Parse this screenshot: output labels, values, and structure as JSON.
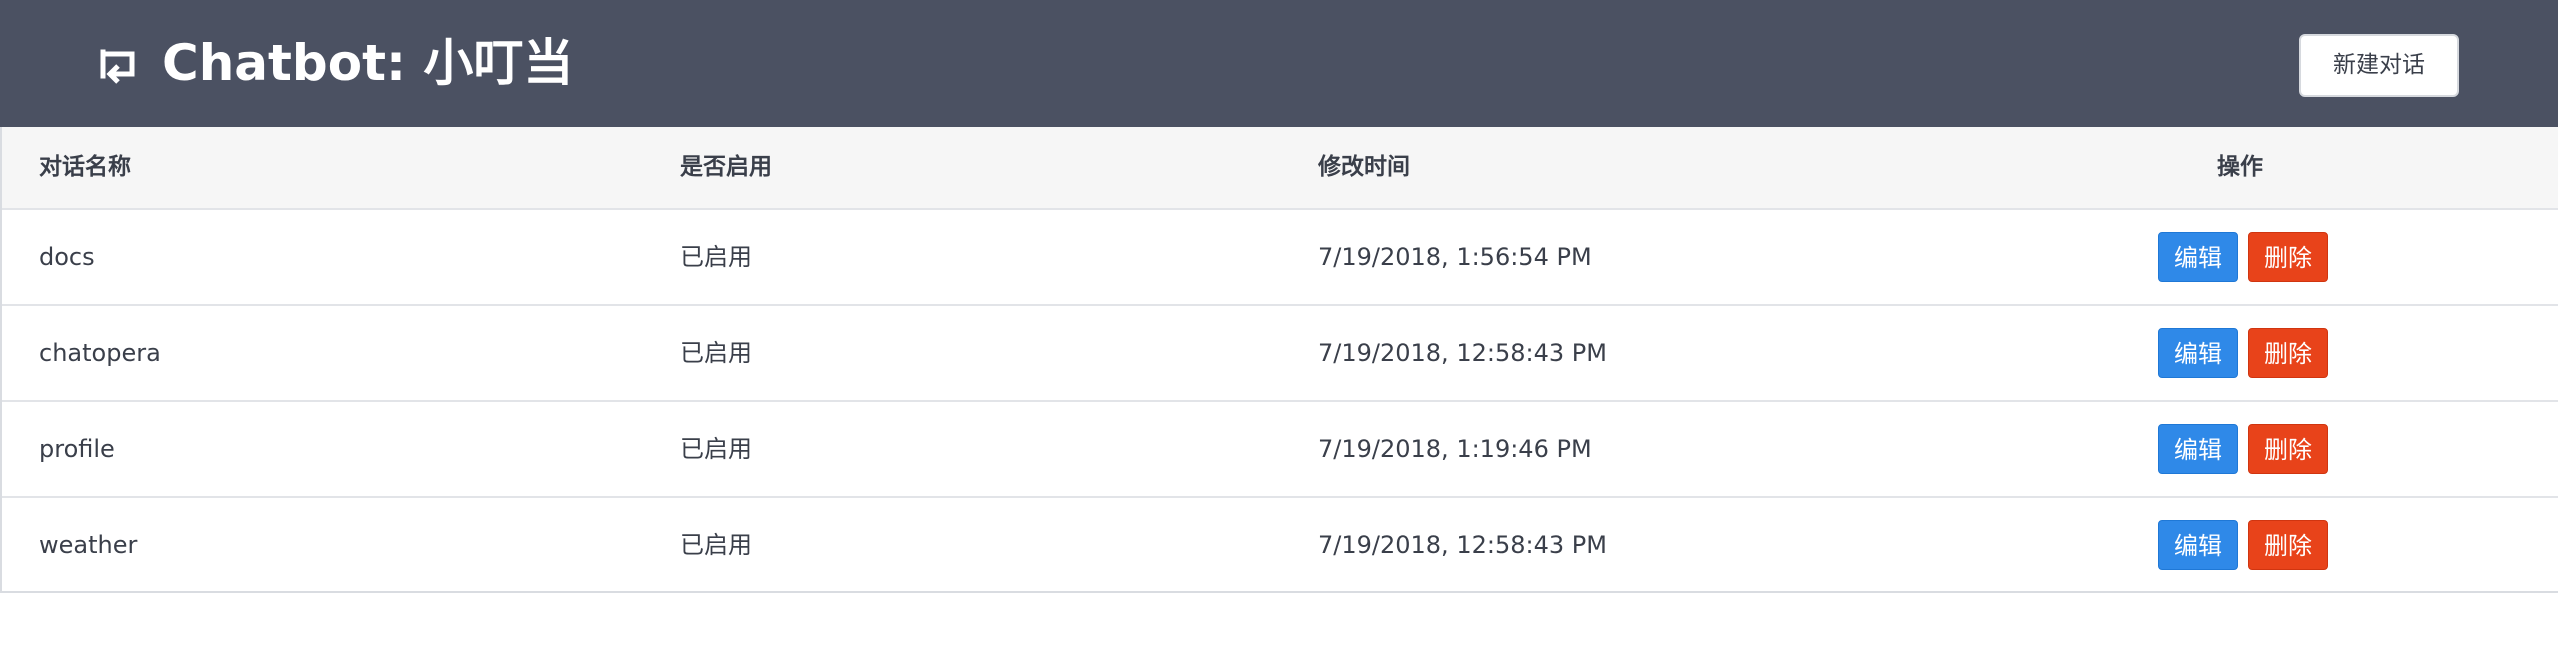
{
  "header": {
    "title": "Chatbot:  小叮当",
    "back_icon": "back-arrow-icon",
    "new_button_label": "新建对话"
  },
  "table": {
    "columns": [
      "对话名称",
      "是否启用",
      "修改时间",
      "操作"
    ],
    "rows": [
      {
        "name": "docs",
        "status": "已启用",
        "modified": "7/19/2018, 1:56:54 PM",
        "edit_label": "编辑",
        "delete_label": "删除"
      },
      {
        "name": "chatopera",
        "status": "已启用",
        "modified": "7/19/2018, 12:58:43 PM",
        "edit_label": "编辑",
        "delete_label": "删除"
      },
      {
        "name": "profile",
        "status": "已启用",
        "modified": "7/19/2018, 1:19:46 PM",
        "edit_label": "编辑",
        "delete_label": "删除"
      },
      {
        "name": "weather",
        "status": "已启用",
        "modified": "7/19/2018, 12:58:43 PM",
        "edit_label": "编辑",
        "delete_label": "删除"
      }
    ]
  },
  "colors": {
    "header_bg": "#4b5162",
    "edit_button": "#2f89e8",
    "delete_button": "#e8431a",
    "table_header_bg": "#f6f6f6"
  }
}
